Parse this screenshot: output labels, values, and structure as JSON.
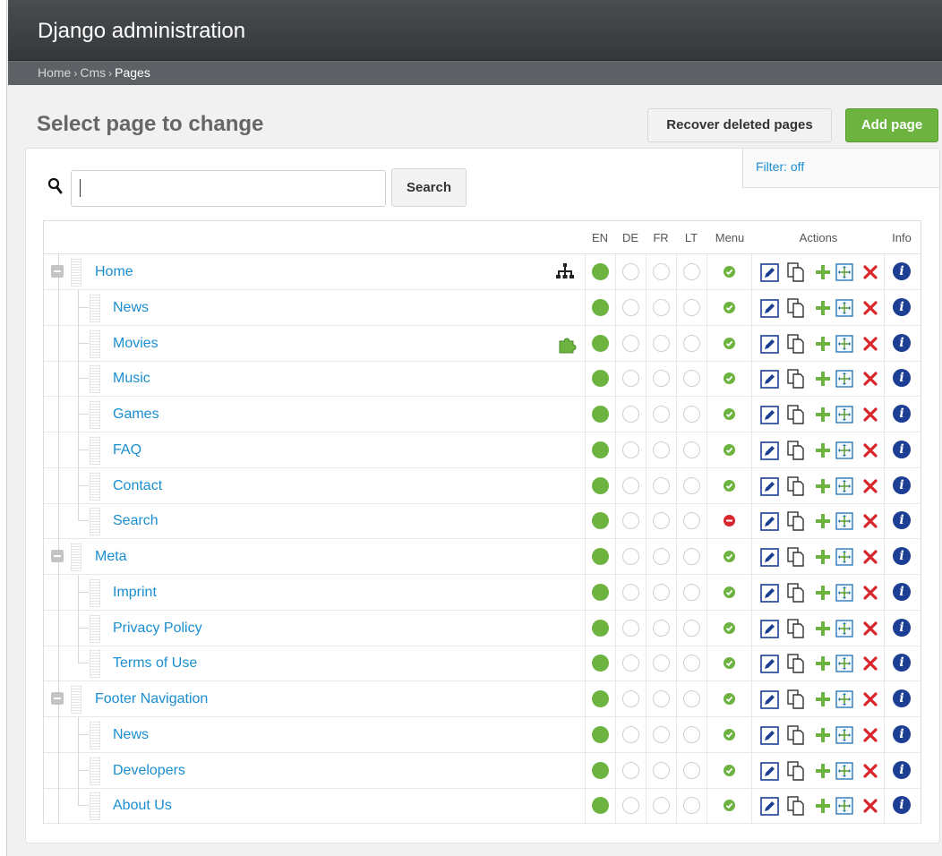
{
  "header": {
    "title": "Django administration"
  },
  "breadcrumbs": [
    {
      "label": "Home"
    },
    {
      "label": "Cms"
    },
    {
      "label": "Pages"
    }
  ],
  "breadcrumb_separator": "›",
  "page_title": "Select page to change",
  "buttons": {
    "recover_label": "Recover deleted pages",
    "add_label": "Add page",
    "search_label": "Search"
  },
  "search": {
    "value": "",
    "placeholder": ""
  },
  "filter": {
    "label": "Filter: off"
  },
  "columns": [
    "EN",
    "DE",
    "FR",
    "LT",
    "Menu",
    "Actions",
    "Info"
  ],
  "icons": {
    "search": "magnifier-icon",
    "collapse": "collapse-minus-icon",
    "sitemap": "sitemap-icon",
    "plugin": "puzzle-plugin-icon",
    "edit": "edit-pencil-icon",
    "copy": "copy-icon",
    "add_child": "add-plus-icon",
    "move": "move-icon",
    "delete": "delete-x-icon",
    "info": "info-icon"
  },
  "colors": {
    "published": "#6cb33f",
    "menu_off": "#d8262c",
    "link": "#1a8ed0",
    "add_button": "#6cb33f",
    "delete": "#d8262c",
    "info": "#1c3f94"
  },
  "pages": [
    {
      "title": "Home",
      "level": 0,
      "expanded": true,
      "extra": "sitemap",
      "en": true,
      "de": false,
      "fr": false,
      "lt": false,
      "menu": true
    },
    {
      "title": "News",
      "level": 1,
      "en": true,
      "de": false,
      "fr": false,
      "lt": false,
      "menu": true
    },
    {
      "title": "Movies",
      "level": 1,
      "extra": "plugin",
      "en": true,
      "de": false,
      "fr": false,
      "lt": false,
      "menu": true
    },
    {
      "title": "Music",
      "level": 1,
      "en": true,
      "de": false,
      "fr": false,
      "lt": false,
      "menu": true
    },
    {
      "title": "Games",
      "level": 1,
      "en": true,
      "de": false,
      "fr": false,
      "lt": false,
      "menu": true
    },
    {
      "title": "FAQ",
      "level": 1,
      "en": true,
      "de": false,
      "fr": false,
      "lt": false,
      "menu": true
    },
    {
      "title": "Contact",
      "level": 1,
      "en": true,
      "de": false,
      "fr": false,
      "lt": false,
      "menu": true
    },
    {
      "title": "Search",
      "level": 1,
      "last": true,
      "en": true,
      "de": false,
      "fr": false,
      "lt": false,
      "menu": false
    },
    {
      "title": "Meta",
      "level": 0,
      "expanded": true,
      "en": true,
      "de": false,
      "fr": false,
      "lt": false,
      "menu": true
    },
    {
      "title": "Imprint",
      "level": 1,
      "en": true,
      "de": false,
      "fr": false,
      "lt": false,
      "menu": true
    },
    {
      "title": "Privacy Policy",
      "level": 1,
      "en": true,
      "de": false,
      "fr": false,
      "lt": false,
      "menu": true
    },
    {
      "title": "Terms of Use",
      "level": 1,
      "last": true,
      "en": true,
      "de": false,
      "fr": false,
      "lt": false,
      "menu": true
    },
    {
      "title": "Footer Navigation",
      "level": 0,
      "expanded": true,
      "en": true,
      "de": false,
      "fr": false,
      "lt": false,
      "menu": true
    },
    {
      "title": "News",
      "level": 1,
      "en": true,
      "de": false,
      "fr": false,
      "lt": false,
      "menu": true
    },
    {
      "title": "Developers",
      "level": 1,
      "en": true,
      "de": false,
      "fr": false,
      "lt": false,
      "menu": true
    },
    {
      "title": "About Us",
      "level": 1,
      "last": true,
      "en": true,
      "de": false,
      "fr": false,
      "lt": false,
      "menu": true
    }
  ]
}
